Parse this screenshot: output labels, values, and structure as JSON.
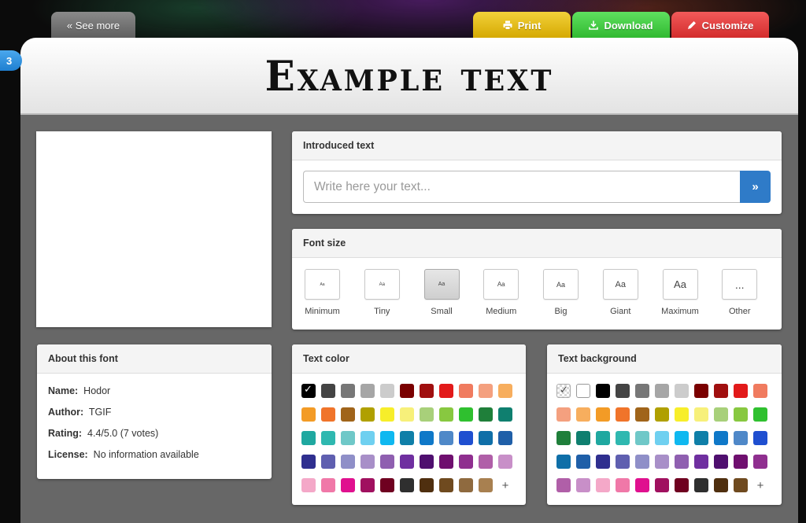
{
  "topbar": {
    "see_more": "«  See more",
    "print": "Print",
    "download": "Download",
    "customize": "Customize"
  },
  "badge": "3",
  "header": {
    "title": "Example text"
  },
  "intro": {
    "title": "Introduced text",
    "placeholder": "Write here your text...",
    "go": "»"
  },
  "font_size": {
    "title": "Font size",
    "options": [
      {
        "label": "Minimum",
        "sample": "Aa",
        "size": 5
      },
      {
        "label": "Tiny",
        "sample": "Aa",
        "size": 6
      },
      {
        "label": "Small",
        "sample": "Aa",
        "size": 7,
        "active": true
      },
      {
        "label": "Medium",
        "sample": "Aa",
        "size": 8
      },
      {
        "label": "Big",
        "sample": "Aa",
        "size": 9
      },
      {
        "label": "Giant",
        "sample": "Aa",
        "size": 11
      },
      {
        "label": "Maximum",
        "sample": "Aa",
        "size": 13
      },
      {
        "label": "Other",
        "sample": "...",
        "size": 14
      }
    ]
  },
  "about": {
    "title": "About this font",
    "rows": [
      {
        "key": "Name:",
        "value": "Hodor"
      },
      {
        "key": "Author:",
        "value": "TGIF"
      },
      {
        "key": "Rating:",
        "value": "4.4/5.0 (7 votes)"
      },
      {
        "key": "License:",
        "value": "No information available"
      }
    ]
  },
  "text_color": {
    "title": "Text color",
    "add": "+",
    "swatches": [
      "#000000",
      "#444444",
      "#777777",
      "#a6a6a6",
      "#cccccc",
      "#7a0000",
      "#a00f0f",
      "#e21a1a",
      "#f07b5f",
      "#f4a07f",
      "#f7ae5e",
      "#f39b26",
      "#f0742a",
      "#a0641a",
      "#b0a000",
      "#f7ee2a",
      "#f7f07a",
      "#a8d07a",
      "#88c840",
      "#2fc02f",
      "#1f7f3a",
      "#0f7f6f",
      "#1fa8a0",
      "#2fb8b0",
      "#6fc8c8",
      "#6fd0f0",
      "#0fb8f0",
      "#0f7fa8",
      "#0f78c8",
      "#4f88c8",
      "#1f4fd0",
      "#0f6fa8",
      "#1f5fa8",
      "#2f2f8f",
      "#5f5fb0",
      "#8f8fc8",
      "#a88fc8",
      "#8f5fb0",
      "#6f2fa0",
      "#4f0f6f",
      "#6f0f6f",
      "#8f2f8f",
      "#b05fa8",
      "#c88fc8",
      "#f4a8c8",
      "#f078a8",
      "#e0108f",
      "#a0105f",
      "#6f0020",
      "#2f2f2f",
      "#4f2f0f",
      "#6f4a1f",
      "#8f6a3f",
      "#a88050",
      "#c8a070",
      "#d8c0a0",
      "#a89080",
      "#787060",
      "#4f4a40"
    ]
  },
  "text_bg": {
    "title": "Text background",
    "add": "+",
    "swatches": [
      "checker",
      "white",
      "#000000",
      "#444444",
      "#777777",
      "#a6a6a6",
      "#cccccc",
      "#7a0000",
      "#a00f0f",
      "#e21a1a",
      "#f07b5f",
      "#f4a07f",
      "#f7ae5e",
      "#f39b26",
      "#f0742a",
      "#a0641a",
      "#b0a000",
      "#f7ee2a",
      "#f7f07a",
      "#a8d07a",
      "#88c840",
      "#2fc02f",
      "#1f7f3a",
      "#0f7f6f",
      "#1fa8a0",
      "#2fb8b0",
      "#6fc8c8",
      "#6fd0f0",
      "#0fb8f0",
      "#0f7fa8",
      "#0f78c8",
      "#4f88c8",
      "#1f4fd0",
      "#0f6fa8",
      "#1f5fa8",
      "#2f2f8f",
      "#5f5fb0",
      "#8f8fc8",
      "#a88fc8",
      "#8f5fb0",
      "#6f2fa0",
      "#4f0f6f",
      "#6f0f6f",
      "#8f2f8f",
      "#b05fa8",
      "#c88fc8",
      "#f4a8c8",
      "#f078a8",
      "#e0108f",
      "#a0105f",
      "#6f0020",
      "#2f2f2f",
      "#4f2f0f",
      "#6f4a1f",
      "#8f6a3f",
      "#a88050",
      "#c8a070",
      "#d8c0a0",
      "#a89080"
    ]
  }
}
